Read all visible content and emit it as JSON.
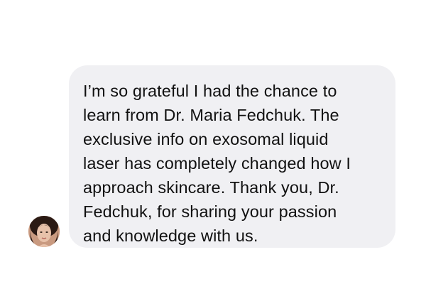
{
  "message": {
    "text": "I’m so grateful I had the chance to\nlearn from Dr. Maria Fedchuk. The\nexclusive info on exosomal liquid\nlaser has completely changed how I\napproach skincare. Thank you, Dr.\nFedchuk, for sharing your passion\nand knowledge with us.",
    "bubble_color": "#f0f0f3",
    "text_color": "#111111"
  },
  "sender": {
    "avatar_icon": "user-photo-avatar"
  }
}
